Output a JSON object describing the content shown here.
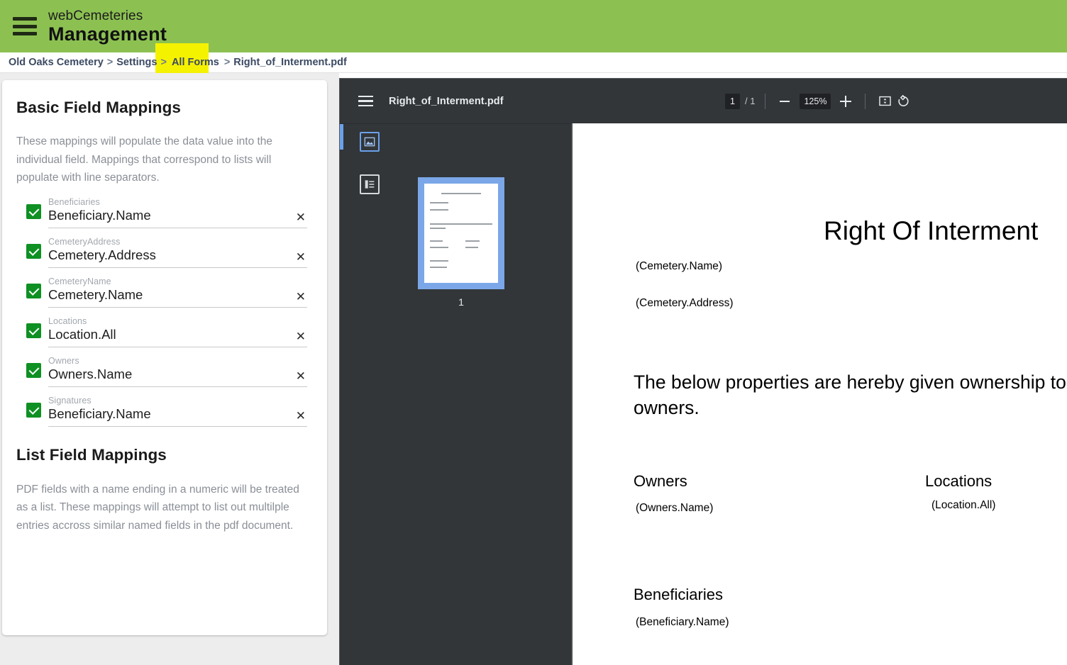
{
  "header": {
    "menu_icon": "hamburger-icon",
    "brand_line1": "webCemeteries",
    "brand_line2": "Management",
    "bg_color": "#8cc152"
  },
  "breadcrumb": {
    "items": [
      {
        "label": "Old Oaks Cemetery",
        "highlighted": false
      },
      {
        "label": "Settings",
        "highlighted": false
      },
      {
        "label": "All Forms",
        "highlighted": true
      },
      {
        "label": "Right_of_Interment.pdf",
        "highlighted": false
      }
    ],
    "separator": ">",
    "highlight_color": "#f5f200"
  },
  "basic_mappings": {
    "title": "Basic Field Mappings",
    "description": "These mappings will populate the data value into the individual field. Mappings that correspond to lists will populate with line separators.",
    "clear_icon": "close-icon",
    "checkbox_color": "#0f9023",
    "fields": [
      {
        "label": "Beneficiaries",
        "value": "Beneficiary.Name",
        "checked": true
      },
      {
        "label": "CemeteryAddress",
        "value": "Cemetery.Address",
        "checked": true
      },
      {
        "label": "CemeteryName",
        "value": "Cemetery.Name",
        "checked": true
      },
      {
        "label": "Locations",
        "value": "Location.All",
        "checked": true
      },
      {
        "label": "Owners",
        "value": "Owners.Name",
        "checked": true
      },
      {
        "label": "Signatures",
        "value": "Beneficiary.Name",
        "checked": true
      }
    ]
  },
  "list_mappings": {
    "title": "List Field Mappings",
    "description": "PDF fields with a name ending in a numeric will be treated as a list. These mappings will attempt to list out multilple entries accross similar named fields in the pdf document."
  },
  "pdf_viewer": {
    "menu_icon": "hamburger-icon",
    "filename": "Right_of_Interment.pdf",
    "current_page": "1",
    "page_total": "/ 1",
    "zoom_out_icon": "minus-icon",
    "zoom_level": "125%",
    "zoom_in_icon": "plus-icon",
    "fit_page_icon": "fit-page-icon",
    "rotate_icon": "rotate-icon",
    "sidebar": {
      "thumbnails_icon": "thumbnails-icon",
      "outline_icon": "document-outline-icon",
      "thumbnail_label": "1"
    },
    "document": {
      "title": "Right Of Interment",
      "cemetery_name": "(Cemetery.Name)",
      "cemetery_address": "(Cemetery.Address)",
      "body": "The below properties are hereby given ownership to the below owners.",
      "owners_heading": "Owners",
      "owners_value": "(Owners.Name)",
      "locations_heading": "Locations",
      "locations_value": "(Location.All)",
      "beneficiaries_heading": "Beneficiaries",
      "beneficiaries_value": "(Beneficiary.Name)"
    }
  }
}
